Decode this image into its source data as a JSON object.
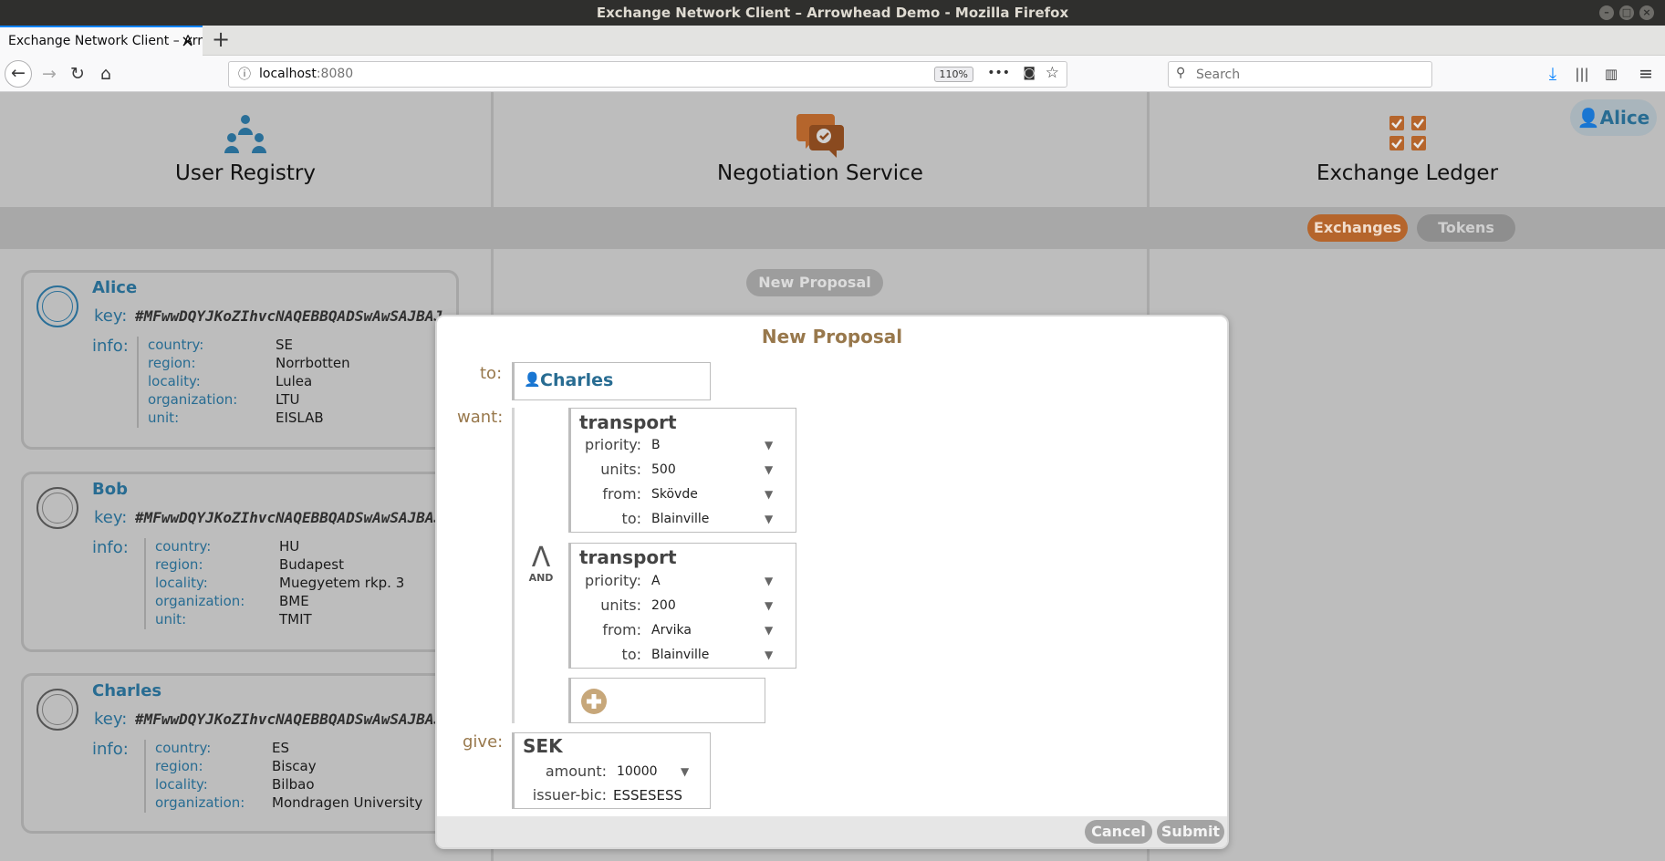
{
  "window": {
    "title": "Exchange Network Client – Arrowhead Demo - Mozilla Firefox"
  },
  "browser": {
    "tab_title": "Exchange Network Client – Arrowhead Demo",
    "url_host": "localhost",
    "url_port": ":8080",
    "zoom": "110%",
    "search_placeholder": "Search"
  },
  "services": [
    {
      "title": "User Registry",
      "icon": "users-icon"
    },
    {
      "title": "Negotiation Service",
      "icon": "chat-bubbles-icon"
    },
    {
      "title": "Exchange Ledger",
      "icon": "checklist-icon"
    }
  ],
  "current_user": "Alice",
  "ledger_tabs": {
    "exchanges": "Exchanges",
    "tokens": "Tokens"
  },
  "negotiation": {
    "new_proposal_button": "New Proposal"
  },
  "users": [
    {
      "name": "Alice",
      "key_label": "key:",
      "key": "#MFwwDQYJKoZIhvcNAQEBBQADSwAwSAJBAJ",
      "info_label": "info:",
      "info": [
        {
          "k": "country:",
          "v": "SE"
        },
        {
          "k": "region:",
          "v": "Norrbotten"
        },
        {
          "k": "locality:",
          "v": "Lulea"
        },
        {
          "k": "organization:",
          "v": "LTU"
        },
        {
          "k": "unit:",
          "v": "EISLAB"
        }
      ]
    },
    {
      "name": "Bob",
      "key_label": "key:",
      "key": "#MFwwDQYJKoZIhvcNAQEBBQADSwAwSAJBAJ",
      "info_label": "info:",
      "info": [
        {
          "k": "country:",
          "v": "HU"
        },
        {
          "k": "region:",
          "v": "Budapest"
        },
        {
          "k": "locality:",
          "v": "Muegyetem rkp. 3"
        },
        {
          "k": "organization:",
          "v": "BME"
        },
        {
          "k": "unit:",
          "v": "TMIT"
        }
      ]
    },
    {
      "name": "Charles",
      "key_label": "key:",
      "key": "#MFwwDQYJKoZIhvcNAQEBBQADSwAwSAJBAJ",
      "info_label": "info:",
      "info": [
        {
          "k": "country:",
          "v": "ES"
        },
        {
          "k": "region:",
          "v": "Biscay"
        },
        {
          "k": "locality:",
          "v": "Bilbao"
        },
        {
          "k": "organization:",
          "v": "Mondragen University"
        }
      ]
    }
  ],
  "modal": {
    "title": "New Proposal",
    "to_label": "to:",
    "to_value": "Charles",
    "want_label": "want:",
    "operator_symbol": "Λ",
    "operator_text": "AND",
    "wants": [
      {
        "title": "transport",
        "fields": [
          {
            "k": "priority:",
            "v": "B"
          },
          {
            "k": "units:",
            "v": "500"
          },
          {
            "k": "from:",
            "v": "Skövde"
          },
          {
            "k": "to:",
            "v": "Blainville"
          }
        ]
      },
      {
        "title": "transport",
        "fields": [
          {
            "k": "priority:",
            "v": "A"
          },
          {
            "k": "units:",
            "v": "200"
          },
          {
            "k": "from:",
            "v": "Arvika"
          },
          {
            "k": "to:",
            "v": "Blainville"
          }
        ]
      }
    ],
    "give_label": "give:",
    "give": {
      "title": "SEK",
      "amount_label": "amount:",
      "amount": "10000",
      "issuer_label": "issuer-bic:",
      "issuer": "ESSESESS"
    },
    "cancel_label": "Cancel",
    "submit_label": "Submit"
  }
}
